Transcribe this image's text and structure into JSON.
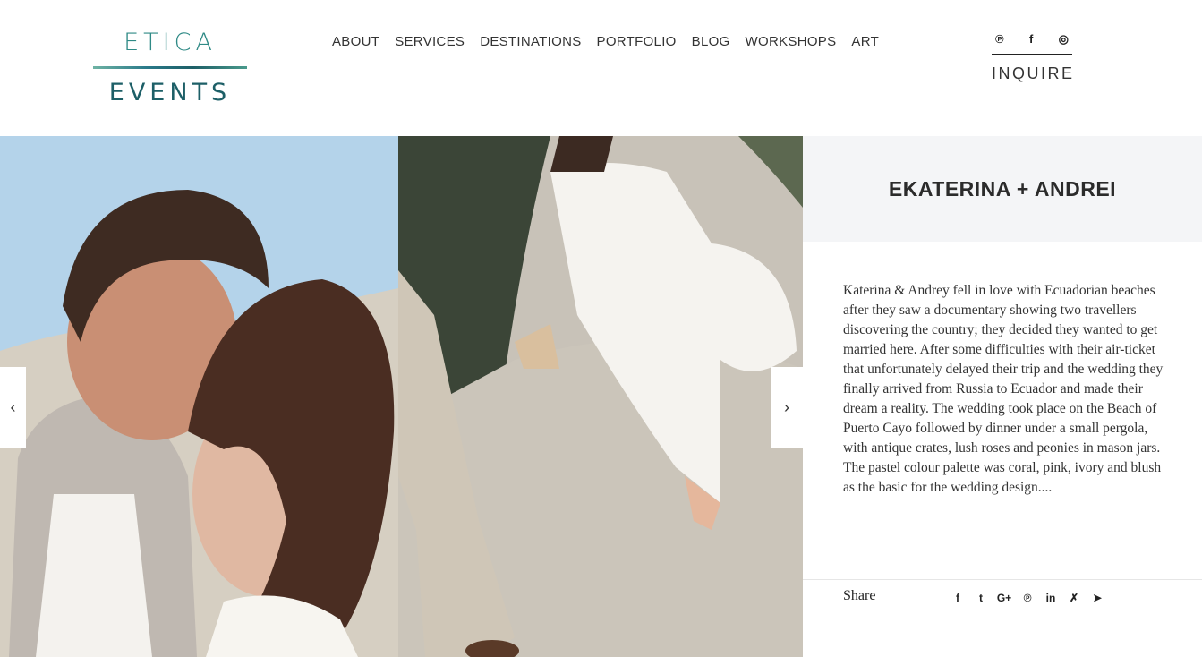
{
  "brand": {
    "logo_top": "ETICA",
    "logo_bottom": "EVENTS"
  },
  "nav": {
    "items": [
      "ABOUT",
      "SERVICES",
      "DESTINATIONS",
      "PORTFOLIO",
      "BLOG",
      "WORKSHOPS",
      "ART"
    ]
  },
  "header_social": {
    "icons": [
      "pinterest-icon",
      "facebook-icon",
      "instagram-icon"
    ]
  },
  "inquire": {
    "label": "INQUIRE"
  },
  "gallery": {
    "prev_icon": "chevron-left-icon",
    "next_icon": "chevron-right-icon"
  },
  "post": {
    "title": "EKATERINA + ANDREI",
    "description": "Katerina & Andrey fell in love with Ecuadorian beaches after they saw a documentary showing two travellers discovering the country; they decided they wanted to get married here. After some difficulties with their air-ticket that unfortunately delayed their trip and the wedding they finally arrived from Russia to Ecuador and made their dream a reality. The wedding took place on the Beach of Puerto Cayo followed by dinner under a small pergola, with antique crates, lush roses and peonies in mason jars. The pastel colour palette was coral, pink, ivory and blush as the basic for the wedding design...."
  },
  "share": {
    "label": "Share",
    "icons": [
      "facebook-icon",
      "twitter-icon",
      "google-plus-icon",
      "pinterest-icon",
      "linkedin-icon",
      "xing-icon",
      "telegram-icon"
    ]
  },
  "colors": {
    "brand_teal": "#2f8a86",
    "brand_dark_teal": "#1d5f67",
    "title_box_bg": "#f4f5f7"
  }
}
